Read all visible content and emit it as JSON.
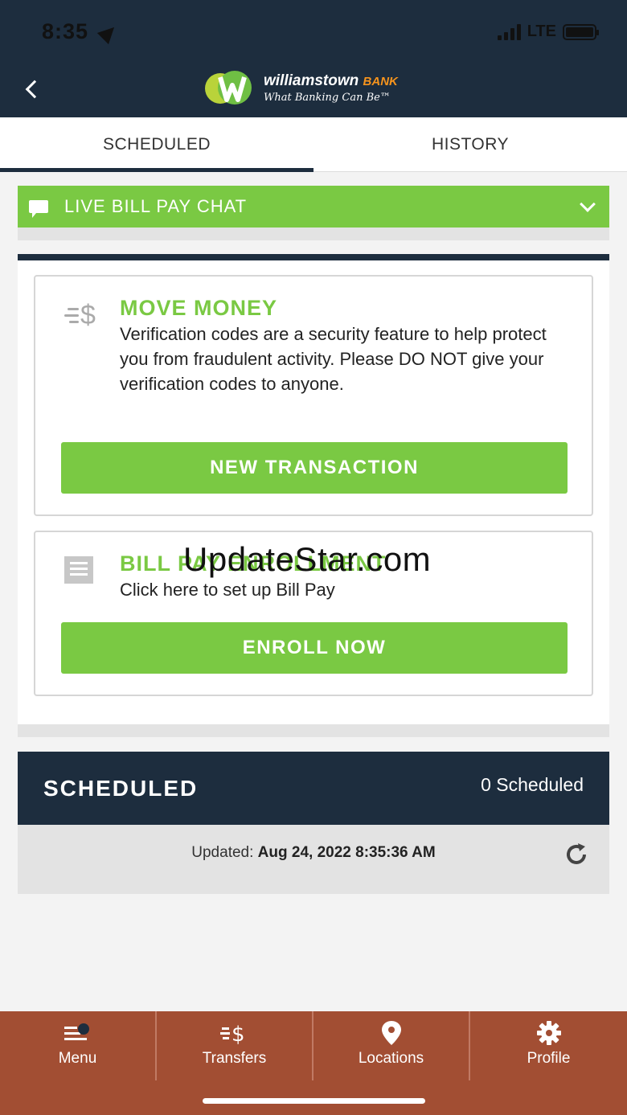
{
  "status_bar": {
    "time": "8:35",
    "network": "LTE"
  },
  "header": {
    "logo_name": "williamstown",
    "logo_bank": "BANK",
    "logo_tagline": "What Banking Can Be™"
  },
  "tabs": [
    {
      "label": "SCHEDULED",
      "active": true
    },
    {
      "label": "HISTORY",
      "active": false
    }
  ],
  "chat": {
    "label": "LIVE BILL PAY CHAT"
  },
  "move_money": {
    "title": "MOVE MONEY",
    "text": "Verification codes are a security feature to help protect you from fraudulent activity. Please DO NOT give your verification codes to anyone.",
    "button": "NEW TRANSACTION"
  },
  "bill_pay": {
    "title": "BILL PAY ENROLLMENT",
    "text": "Click here to set up Bill Pay",
    "button": "ENROLL NOW"
  },
  "watermark": "UpdateStar.com",
  "scheduled": {
    "title": "SCHEDULED",
    "count": "0 Scheduled",
    "updated_label": "Updated:",
    "updated_value": "Aug 24, 2022 8:35:36 AM"
  },
  "bottom_nav": [
    {
      "label": "Menu",
      "icon": "menu-icon"
    },
    {
      "label": "Transfers",
      "icon": "transfer-icon"
    },
    {
      "label": "Locations",
      "icon": "location-pin-icon"
    },
    {
      "label": "Profile",
      "icon": "gear-icon"
    }
  ],
  "colors": {
    "navy": "#1d2d3e",
    "green": "#7ac943",
    "rust": "#a24e33"
  }
}
